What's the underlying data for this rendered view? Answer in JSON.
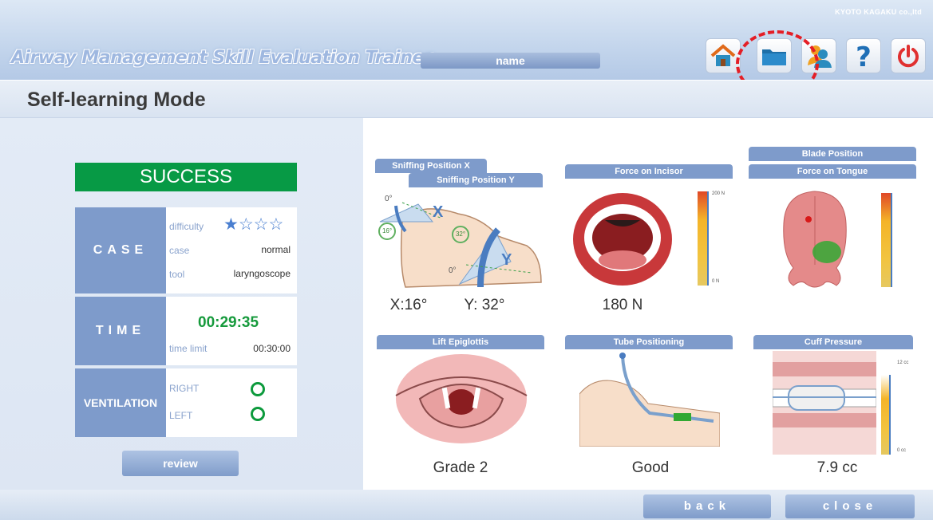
{
  "header": {
    "brand": "KYOTO KAGAKU co.,ltd",
    "app_title": "Airway Management Skill Evaluation Trainer",
    "name_field": "name",
    "toolbar": [
      {
        "icon": "home-icon",
        "label": "Home"
      },
      {
        "icon": "folder-icon",
        "label": "Open"
      },
      {
        "icon": "user-icon",
        "label": "User"
      },
      {
        "icon": "help-icon",
        "label": "?"
      },
      {
        "icon": "power-icon",
        "label": "Exit"
      }
    ],
    "accent": "#e41e26"
  },
  "mode_title": "Self-learning Mode",
  "result": {
    "status": "SUCCESS",
    "status_color": "#079a45",
    "case_label": "CASE",
    "difficulty_label": "difficulty",
    "difficulty_stars": "★☆☆☆",
    "case_key": "case",
    "case_value": "normal",
    "tool_key": "tool",
    "tool_value": "laryngoscope",
    "time_label": "TIME",
    "time_value": "00:29:35",
    "time_limit_key": "time limit",
    "time_limit_value": "00:30:00",
    "ventilation_label": "VENTILATION",
    "right_label": "RIGHT",
    "left_label": "LEFT",
    "review_button": "review"
  },
  "panels": {
    "sniffing_x": "Sniffing Position X",
    "sniffing_y": "Sniffing Position Y",
    "sniffing_value_x": "X:16°",
    "sniffing_value_y": "Y: 32°",
    "diagram_x_angle": "16°",
    "diagram_y_angle": "32°",
    "diagram_zero": "0°",
    "force_incisor": "Force on Incisor",
    "force_incisor_value": "180 N",
    "incisor_scale_max": "200 N",
    "incisor_scale_min": "0 N",
    "blade_position": "Blade Position",
    "force_tongue": "Force on Tongue",
    "lift_epiglottis": "Lift Epiglottis",
    "lift_value": "Grade 2",
    "tube_positioning": "Tube Positioning",
    "tube_value": "Good",
    "cuff_pressure": "Cuff Pressure",
    "cuff_value": "7.9 cc",
    "cuff_scale_max": "12 cc",
    "cuff_scale_min": "0 cc"
  },
  "footer": {
    "back": "back",
    "close": "close"
  }
}
